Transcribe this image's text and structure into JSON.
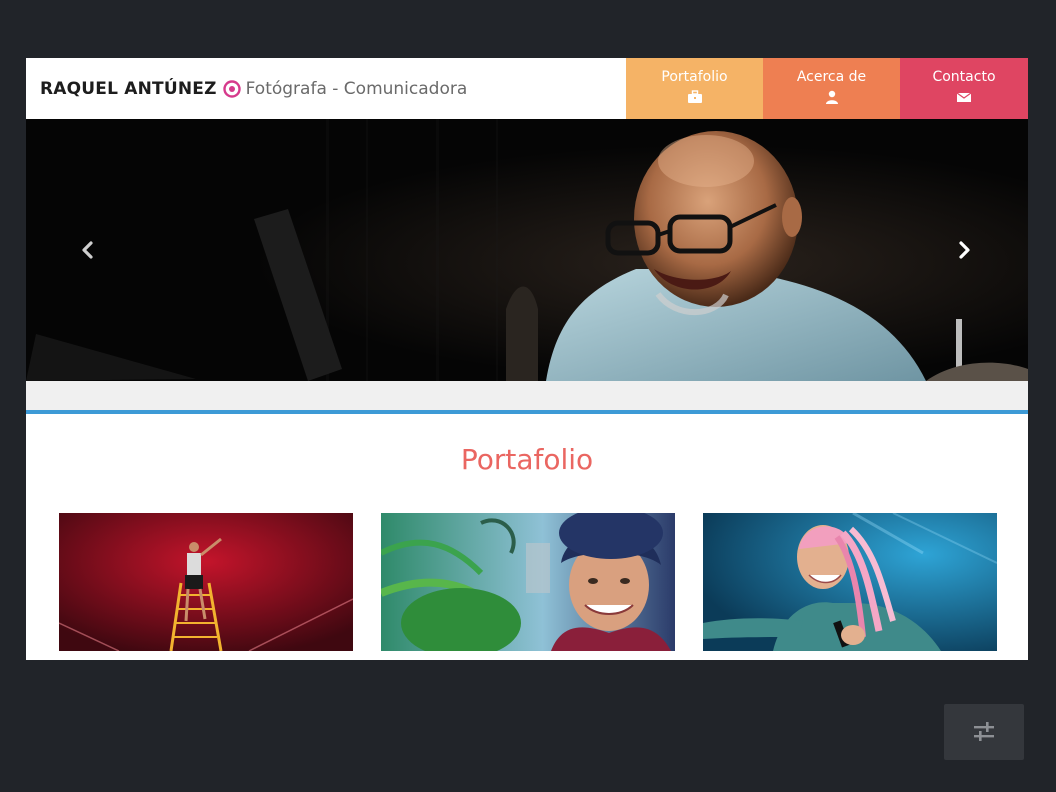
{
  "brand": {
    "name": "RAQUEL ANTÚNEZ",
    "tagline": "Fotógrafa - Comunicadora",
    "dot_icon": "target-icon",
    "accent_color": "#d63a8c"
  },
  "nav": {
    "items": [
      {
        "label": "Portafolio",
        "icon": "briefcase-icon",
        "color": "#f5b366"
      },
      {
        "label": "Acerca de",
        "icon": "user-icon",
        "color": "#ee7f52"
      },
      {
        "label": "Contacto",
        "icon": "envelope-icon",
        "color": "#df4562"
      }
    ]
  },
  "hero": {
    "prev_icon": "chevron-left-icon",
    "next_icon": "chevron-right-icon",
    "slides_count": 3,
    "active_slide": 1
  },
  "portfolio": {
    "title": "Portafolio",
    "title_color": "#ea6661",
    "rule_color": "#3d9ad6"
  },
  "settings": {
    "icon": "sliders-icon"
  }
}
